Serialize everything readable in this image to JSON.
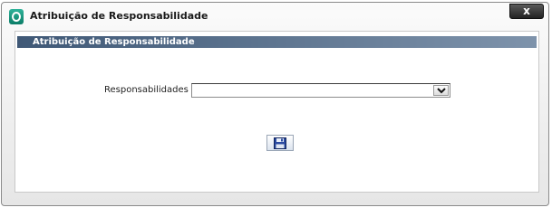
{
  "window": {
    "title": "Atribuição de Responsabilidade",
    "close_label": "x"
  },
  "section": {
    "header": "Atribuição de Responsabilidade"
  },
  "form": {
    "field_label": "Responsabilidades",
    "select_value": ""
  },
  "icons": {
    "app": "app-logo-icon",
    "dropdown": "chevron-down-icon",
    "save": "floppy-disk-icon"
  },
  "colors": {
    "section_header_start": "#3f5876",
    "section_header_end": "#7e93ab",
    "app_icon": "#149c83"
  }
}
